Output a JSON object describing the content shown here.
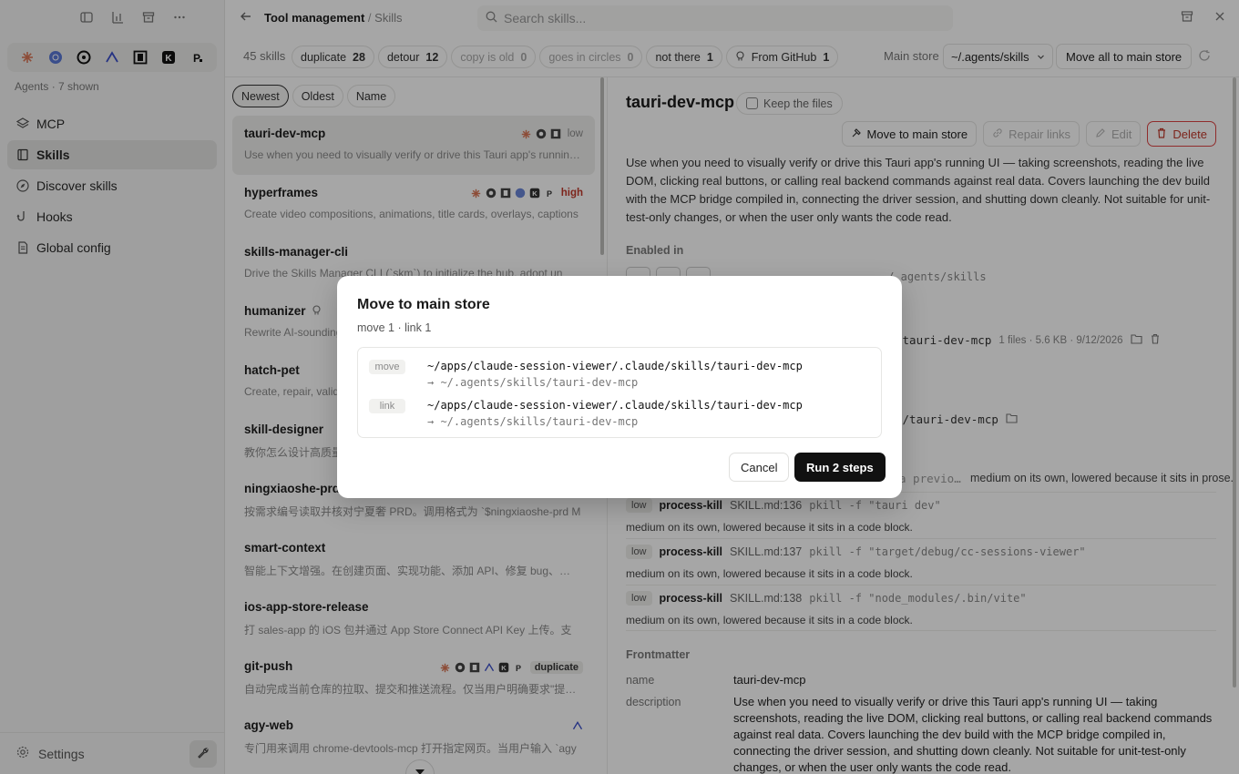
{
  "sidebar": {
    "agents_label": "Agents · 7 shown",
    "nav": [
      {
        "label": "MCP",
        "icon": "layers-icon"
      },
      {
        "label": "Skills",
        "icon": "book-icon"
      },
      {
        "label": "Discover skills",
        "icon": "compass-icon"
      },
      {
        "label": "Hooks",
        "icon": "hook-icon"
      },
      {
        "label": "Global config",
        "icon": "file-icon"
      }
    ],
    "settings_label": "Settings"
  },
  "topbar": {
    "crumb_parent": "Tool management",
    "crumb_sep": "/",
    "crumb_current": "Skills",
    "search_placeholder": "Search skills..."
  },
  "filters": {
    "count": "45 skills",
    "chips": [
      {
        "label": "duplicate",
        "count": "28"
      },
      {
        "label": "detour",
        "count": "12"
      },
      {
        "label": "copy is old",
        "count": "0"
      },
      {
        "label": "goes in circles",
        "count": "0"
      },
      {
        "label": "not there",
        "count": "1"
      },
      {
        "label": "From GitHub",
        "count": "1"
      }
    ],
    "main_store_label": "Main store",
    "main_store_value": "~/.agents/skills",
    "move_all_label": "Move all to main store"
  },
  "sorts": [
    "Newest",
    "Oldest",
    "Name"
  ],
  "skills": [
    {
      "name": "tauri-dev-mcp",
      "desc": "Use when you need to visually verify or drive this Tauri app's running UI — taking screenshots",
      "tag": "low"
    },
    {
      "name": "hyperframes",
      "desc": "Create video compositions, animations, title cards, overlays, captions",
      "tag": "high"
    },
    {
      "name": "skills-manager-cli",
      "desc": "Drive the Skills Manager CLI (`skm`) to initialize the hub, adopt un",
      "tag": ""
    },
    {
      "name": "humanizer",
      "desc": "Rewrite AI-sounding text",
      "tag": ""
    },
    {
      "name": "hatch-pet",
      "desc": "Create, repair, validate",
      "tag": ""
    },
    {
      "name": "skill-designer",
      "desc": "教你怎么设计高质量",
      "tag": ""
    },
    {
      "name": "ningxiaoshe-prd",
      "desc": "按需求编号读取并核对宁夏奢 PRD。调用格式为 `$ningxiaoshe-prd M",
      "tag": ""
    },
    {
      "name": "smart-context",
      "desc": "智能上下文增强。在创建页面、实现功能、添加 API、修复 bug、重构",
      "tag": ""
    },
    {
      "name": "ios-app-store-release",
      "desc": "打 sales-app 的 iOS 包并通过 App Store Connect API Key 上传。支",
      "tag": ""
    },
    {
      "name": "git-push",
      "desc": "自动完成当前仓库的拉取、提交和推送流程。仅当用户明确要求\"提交并",
      "tag": "duplicate"
    },
    {
      "name": "agy-web",
      "desc": "专门用来调用 chrome-devtools-mcp 打开指定网页。当用户输入 `agy",
      "tag": ""
    }
  ],
  "detail": {
    "title": "tauri-dev-mcp",
    "keep_files_label": "Keep the files",
    "actions": {
      "move": "Move to main store",
      "repair": "Repair links",
      "edit": "Edit",
      "delete": "Delete"
    },
    "description": "Use when you need to visually verify or drive this Tauri app's running UI — taking screenshots, reading the live DOM, clicking real buttons, or calling real backend commands against real data. Covers launching the dev build with the MCP bridge compiled in, connecting the driver session, and shutting down cleanly. Not suitable for unit-test-only changes, or when the user only wants the code read.",
    "enabled_in_label": "Enabled in",
    "enabled_path": "~/.agents/skills",
    "file_path": "/tauri-dev-mcp",
    "file_meta": "1 files · 5.6 KB · 9/12/2026",
    "file_path2": "s/tauri-dev-mcp",
    "risk_partial": "a previo…",
    "risk_partial_note": "medium on its own, lowered because it sits in prose.",
    "risks": [
      {
        "level": "low",
        "kind": "process-kill",
        "loc": "SKILL.md:136",
        "code": "pkill -f \"tauri dev\"",
        "note": "medium on its own, lowered because it sits in a code block."
      },
      {
        "level": "low",
        "kind": "process-kill",
        "loc": "SKILL.md:137",
        "code": "pkill -f \"target/debug/cc-sessions-viewer\"",
        "note": "medium on its own, lowered because it sits in a code block."
      },
      {
        "level": "low",
        "kind": "process-kill",
        "loc": "SKILL.md:138",
        "code": "pkill -f \"node_modules/.bin/vite\"",
        "note": "medium on its own, lowered because it sits in a code block."
      }
    ],
    "frontmatter_label": "Frontmatter",
    "fm_name_key": "name",
    "fm_name_val": "tauri-dev-mcp",
    "fm_desc_key": "description",
    "fm_desc_val": "Use when you need to visually verify or drive this Tauri app's running UI — taking screenshots, reading the live DOM, clicking real buttons, or calling real backend commands against real data. Covers launching the dev build with the MCP bridge compiled in, connecting the driver session, and shutting down cleanly. Not suitable for unit-test-only changes, or when the user only wants the code read."
  },
  "modal": {
    "title": "Move to main store",
    "subtitle": "move 1 · link 1",
    "steps": [
      {
        "kind": "move",
        "src": "~/apps/claude-session-viewer/.claude/skills/tauri-dev-mcp",
        "dst": "→ ~/.agents/skills/tauri-dev-mcp"
      },
      {
        "kind": "link",
        "src": "~/apps/claude-session-viewer/.claude/skills/tauri-dev-mcp",
        "dst": "→ ~/.agents/skills/tauri-dev-mcp"
      }
    ],
    "cancel_label": "Cancel",
    "run_label": "Run 2 steps"
  },
  "colors": {
    "accent": "#111111",
    "danger": "#c0392b",
    "claude": "#d97757"
  }
}
